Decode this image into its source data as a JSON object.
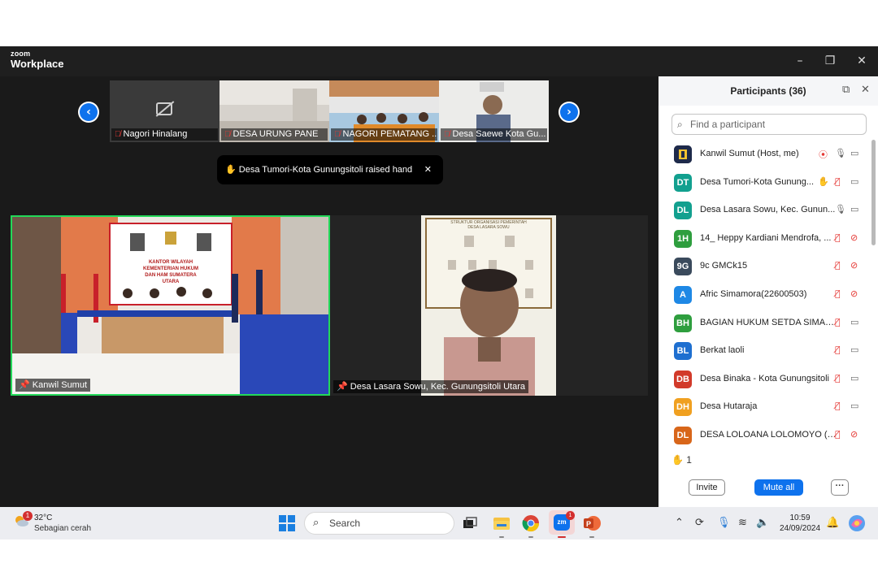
{
  "window": {
    "brand_small": "zoom",
    "brand_large": "Workplace",
    "minimize": "–",
    "restore": "❐",
    "close": "✕"
  },
  "thumbnails": [
    {
      "name": "Nagori Hinalang",
      "camera_off": true
    },
    {
      "name": "DESA URUNG PANE",
      "camera_off": false
    },
    {
      "name": "NAGORI PEMATANG ...",
      "camera_off": false
    },
    {
      "name": "Desa Saewe Kota Gu...",
      "camera_off": false
    }
  ],
  "nav": {
    "prev": "‹",
    "next": "›"
  },
  "toast": {
    "icon": "✋",
    "text": "Desa Tumori-Kota Gunungsitoli raised hand",
    "close": "✕"
  },
  "videos": {
    "main_label": "Kanwil Sumut",
    "second_label": "Desa Lasara Sowu, Kec. Gunungsitoli Utara",
    "banner_line1": "KANTOR WILAYAH",
    "banner_line2": "KEMENTERIAN HUKUM DAN HAM SUMATERA UTARA",
    "board_title_1": "STRUKTUR ORGANISASI PEMERINTAH",
    "board_title_2": "DESA LASARA SOWU"
  },
  "panel": {
    "title": "Participants (36)",
    "popout_icon": "⧉",
    "close_icon": "✕",
    "search_placeholder": "Find a participant",
    "participants": [
      {
        "initials": "",
        "name": "Kanwil Sumut (Host, me)",
        "color": "#1e2a4a",
        "mic": "on",
        "cam": "on",
        "hand": false,
        "rec": true
      },
      {
        "initials": "DT",
        "name": "Desa Tumori-Kota Gunung...",
        "color": "#12a08f",
        "mic": "muted",
        "cam": "on",
        "hand": true
      },
      {
        "initials": "DL",
        "name": "Desa Lasara Sowu, Kec. Gunun...",
        "color": "#12a08f",
        "mic": "on",
        "cam": "on",
        "hand": false
      },
      {
        "initials": "1H",
        "name": "14_ Heppy Kardiani Mendrofa, ...",
        "color": "#2e9e3e",
        "mic": "muted",
        "cam": "off",
        "hand": false
      },
      {
        "initials": "9G",
        "name": "9c GMCk15",
        "color": "#3a4a5c",
        "mic": "muted",
        "cam": "off",
        "hand": false
      },
      {
        "initials": "A",
        "name": "Afric Simamora(22600503)",
        "color": "#1e88e5",
        "mic": "muted",
        "cam": "off",
        "hand": false
      },
      {
        "initials": "BH",
        "name": "BAGIAN HUKUM SETDA SIMAL...",
        "color": "#2e9e3e",
        "mic": "muted",
        "cam": "on",
        "hand": false
      },
      {
        "initials": "BL",
        "name": "Berkat laoli",
        "color": "#1e6fd0",
        "mic": "muted",
        "cam": "on",
        "hand": false
      },
      {
        "initials": "DB",
        "name": "Desa Binaka - Kota Gunungsitoli",
        "color": "#d23a2a",
        "mic": "muted",
        "cam": "on",
        "hand": false
      },
      {
        "initials": "DH",
        "name": "Desa Hutaraja",
        "color": "#f0a020",
        "mic": "muted",
        "cam": "on",
        "hand": false
      },
      {
        "initials": "DL",
        "name": "DESA LOLOANA LOLOMOYO (Y...",
        "color": "#d8661a",
        "mic": "muted",
        "cam": "off",
        "hand": false
      }
    ],
    "raised_icon": "✋",
    "raised_count": "1",
    "invite": "Invite",
    "mute_all": "Mute all",
    "more": "···"
  },
  "taskbar": {
    "weather_badge": "1",
    "temperature": "32°C",
    "weather_desc": "Sebagian cerah",
    "search": "Search",
    "zoom_badge": "1",
    "time": "10:59",
    "date": "24/09/2024"
  }
}
